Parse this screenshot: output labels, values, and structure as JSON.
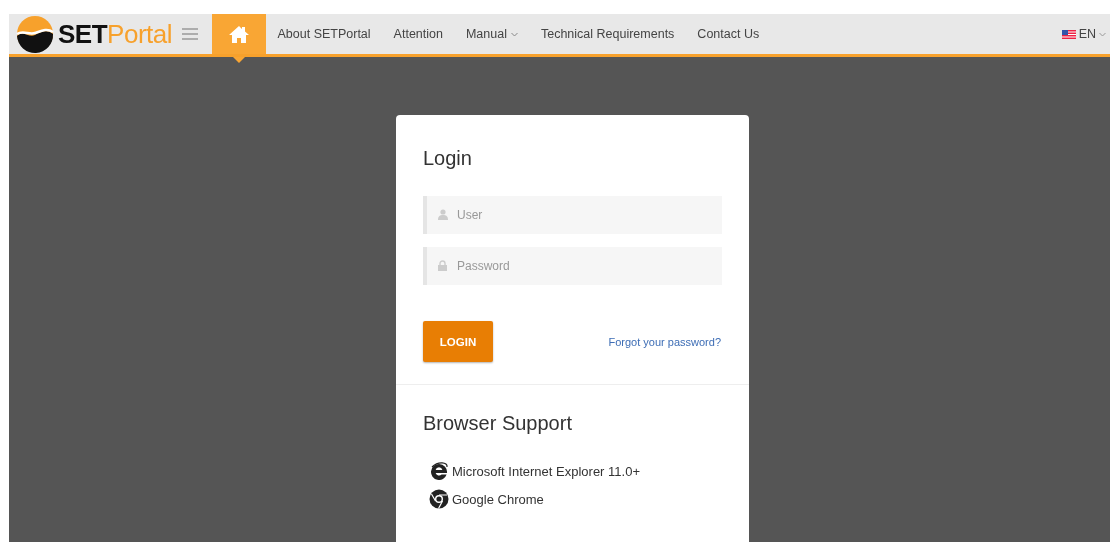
{
  "header": {
    "logo": {
      "strong": "SET",
      "light": "Portal"
    },
    "nav": [
      {
        "kind": "home",
        "selected": true
      },
      {
        "kind": "link",
        "label": "About SETPortal",
        "selected": false
      },
      {
        "kind": "link",
        "label": "Attention",
        "selected": false
      },
      {
        "kind": "dropdown",
        "label": "Manual",
        "selected": false
      },
      {
        "kind": "link",
        "label": "Technical Requirements",
        "selected": false
      },
      {
        "kind": "link",
        "label": "Contact Us",
        "selected": false
      }
    ],
    "language": "EN"
  },
  "login": {
    "title": "Login",
    "fields": [
      {
        "kind": "user",
        "placeholder": "User"
      },
      {
        "kind": "password",
        "placeholder": "Password"
      }
    ],
    "button": "LOGIN",
    "forgot_link": "Forgot your password?"
  },
  "browser_support": {
    "title": "Browser Support",
    "items": [
      {
        "kind": "ie",
        "label": "Microsoft Internet Explorer 11.0+"
      },
      {
        "kind": "chrome",
        "label": "Google Chrome"
      }
    ]
  }
}
